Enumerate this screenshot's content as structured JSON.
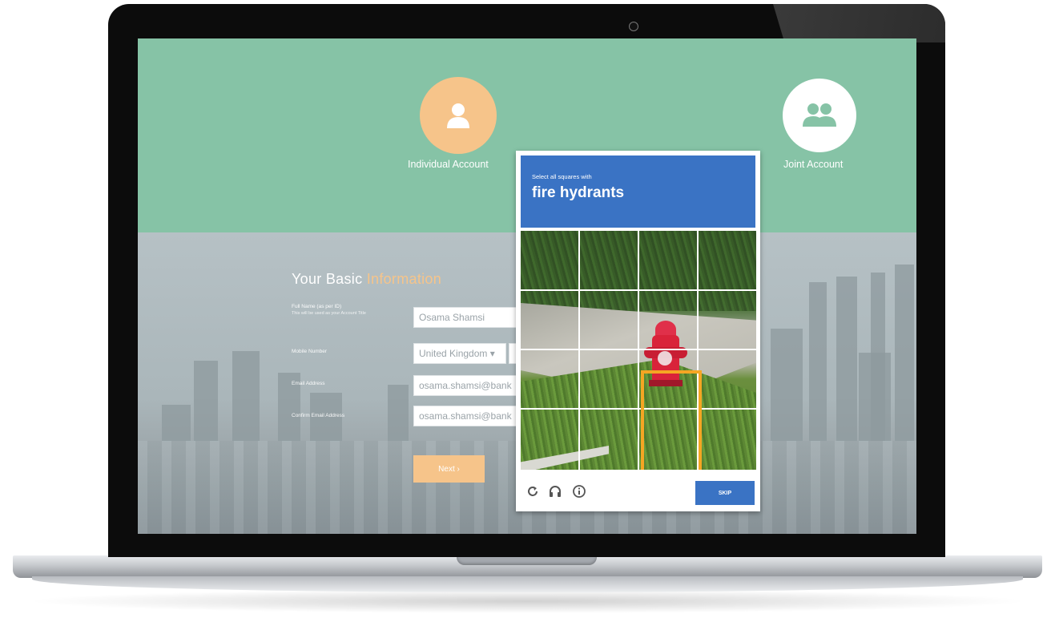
{
  "accounts": [
    {
      "label": "Individual Account",
      "icon": "user-icon",
      "color": "#f6c48a"
    },
    {
      "label": "Joint Account",
      "icon": "users-icon",
      "color": "#ffffff"
    }
  ],
  "form": {
    "title_main": "Your Basic",
    "title_accent": "Information",
    "name_label": "Full Name (as per ID)",
    "name_sublabel": "This will be used as your Account Title",
    "name_value": "Osama Shamsi",
    "mobile_label": "Mobile Number",
    "mobile_country": "United Kingdom ▾",
    "email_label": "Email Address",
    "email_value": "osama.shamsi@bank",
    "confirm_label": "Confirm Email Address",
    "confirm_value": "osama.shamsi@bank",
    "next_label": "Next ›"
  },
  "captcha": {
    "instruction": "Select all squares with",
    "target": "fire hydrants",
    "skip_label": "SKIP",
    "footer_icons": [
      "reload-icon",
      "audio-icon",
      "info-icon"
    ],
    "accent_color": "#3a73c4",
    "highlight_color": "#f5a623"
  },
  "colors": {
    "header_band": "#86c3a6",
    "accent": "#f6c48a"
  }
}
